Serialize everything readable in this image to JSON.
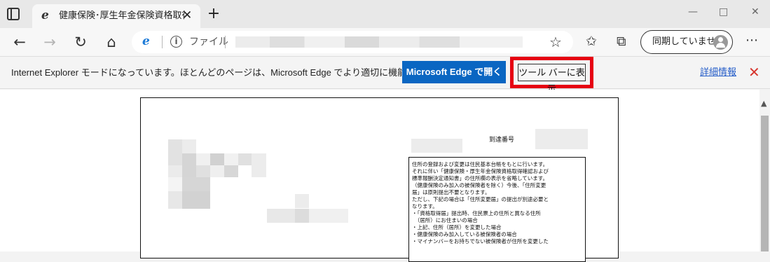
{
  "browser": {
    "tab_title": "健康保険･厚生年金保険資格取得",
    "new_tab_symbol": "+",
    "tab_close_symbol": "✕",
    "window_controls": [
      "—",
      "□",
      "✕"
    ],
    "address_scheme_label": "ファイル",
    "profile_label": "同期していません",
    "icons": [
      "tab-actions-icon",
      "ie-icon",
      "back-arrow-icon",
      "forward-arrow-icon",
      "refresh-icon",
      "home-icon",
      "info-icon",
      "add-favorite-icon",
      "favorites-icon",
      "collections-icon",
      "profile-avatar-icon",
      "more-icon"
    ]
  },
  "ie_mode_bar": {
    "message": "Internet Explorer モードになっています。ほとんどのページは、Microsoft Edge でより適切に機能します。",
    "open_button": "Microsoft Edge で開く",
    "toolbar_button": "ツール バーに表示",
    "details_link": "詳細情報",
    "close_symbol": "✕",
    "highlight_color": "#e60012"
  },
  "document": {
    "arrival_label": "到達番号",
    "notice_lines": [
      "住所の登録および変更は住民基本台帳をもとに行います。",
      "それに伴い「健康保険・厚生年金保険資格取得確認および",
      "標準報酬決定通知書」の住所欄の表示を省略しています。",
      "（健康保険のみ加入の被保険者を除く）今後、「住所変更",
      "届」は原則提出不要となります。",
      "ただし、下記の場合は「住所変更届」の提出が別途必要と",
      "なります。",
      "・「資格取得届」提出時、住民票上の住所と異なる住所",
      "　（居所）にお住まいの場合",
      "・上記、住所（居所）を変更した場合",
      "・健康保険のみ加入している被保険者の場合",
      "・マイナンバーをお持ちでない被保険者が住所を変更した"
    ]
  }
}
